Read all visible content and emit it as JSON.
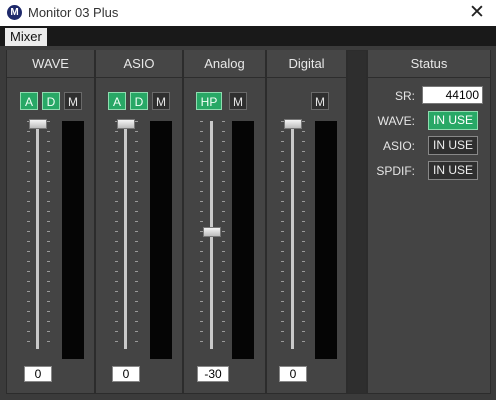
{
  "window": {
    "title": "Monitor 03 Plus",
    "icon_letter": "M",
    "close_glyph": "✕"
  },
  "menu": {
    "tabs": [
      {
        "label": "Mixer"
      }
    ]
  },
  "channels": [
    {
      "name": "WAVE",
      "buttons": [
        "A",
        "D",
        "M"
      ],
      "value": "0",
      "fader_level": 1.0
    },
    {
      "name": "ASIO",
      "buttons": [
        "A",
        "D",
        "M"
      ],
      "value": "0",
      "fader_level": 1.0
    },
    {
      "name": "Analog",
      "buttons": [
        "HP",
        "M"
      ],
      "value": "-30",
      "fader_level": 0.55
    },
    {
      "name": "Digital",
      "buttons": [
        "M"
      ],
      "value": "0",
      "fader_level": 1.0
    }
  ],
  "status": {
    "title": "Status",
    "sr_label": "SR:",
    "sr_value": "44100",
    "rows": [
      {
        "label": "WAVE:",
        "state": "IN USE",
        "active": true
      },
      {
        "label": "ASIO:",
        "state": "IN USE",
        "active": false
      },
      {
        "label": "SPDIF:",
        "state": "IN USE",
        "active": false
      }
    ]
  },
  "colors": {
    "active_green": "#28a866",
    "panel_bg": "#444444",
    "meter_bg": "#050505"
  }
}
